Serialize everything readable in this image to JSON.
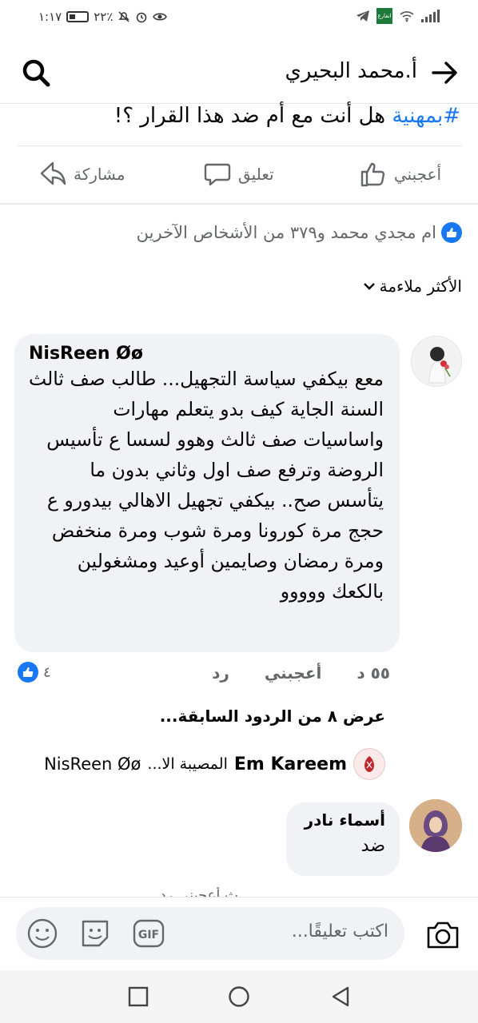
{
  "status_bar": {
    "time": "١:١٧",
    "battery": "٢٢٪",
    "app_badge": "انفارع"
  },
  "header": {
    "title": "أ.محمد البحيري"
  },
  "post": {
    "hashtag": "#بمهنية",
    "question": " هل أنت مع أم ضد هذا القرار ؟!"
  },
  "actions": {
    "like": "أعجبني",
    "comment": "تعليق",
    "share": "مشاركة"
  },
  "reactions_summary": "ام مجدي محمد و٣٧٩ من الأشخاص الآخرين",
  "sort_label": "الأكثر ملاءمة",
  "comments": [
    {
      "author": "NisReen Øø",
      "text": "معع بيكفي سياسة التجهيل... طالب صف ثالث السنة الجاية كيف بدو يتعلم مهارات واساسيات صف ثالث وهوو لسسا ع تأسيس الروضة وترفع صف اول وثاني بدون ما يتأسس صح.. بيكفي تجهيل الاهالي بيدورو ع حجج مرة كورونا ومرة شوب ومرة منخفض ومرة رمضان وصايمين أوعيد ومشغولين بالكعك ووووو",
      "time": "٥٥ د",
      "like_label": "أعجبني",
      "reply_label": "رد",
      "like_count": "٤"
    },
    {
      "author": "أسماء نادر",
      "text": "ضد"
    }
  ],
  "previous_replies": "عرض ٨ من الردود السابقة...",
  "latest_reply": {
    "author": "Em Kareem",
    "text": "المصيبة الا...",
    "mention": "NisReen Øø"
  },
  "cutoff_text": "ث  أعجبني  رد",
  "composer": {
    "placeholder": "اكتب تعليقًا..."
  },
  "icons": {
    "search": "search-icon",
    "back": "arrow-right-icon",
    "like": "thumbs-up-icon",
    "comment": "speech-bubble-icon",
    "share": "share-arrow-icon",
    "camera": "camera-icon",
    "gif": "gif-icon",
    "sticker": "sticker-icon",
    "emoji": "emoji-icon"
  },
  "colors": {
    "accent": "#1877f2",
    "bubble": "#f0f2f5",
    "secondary_text": "#65676b"
  }
}
